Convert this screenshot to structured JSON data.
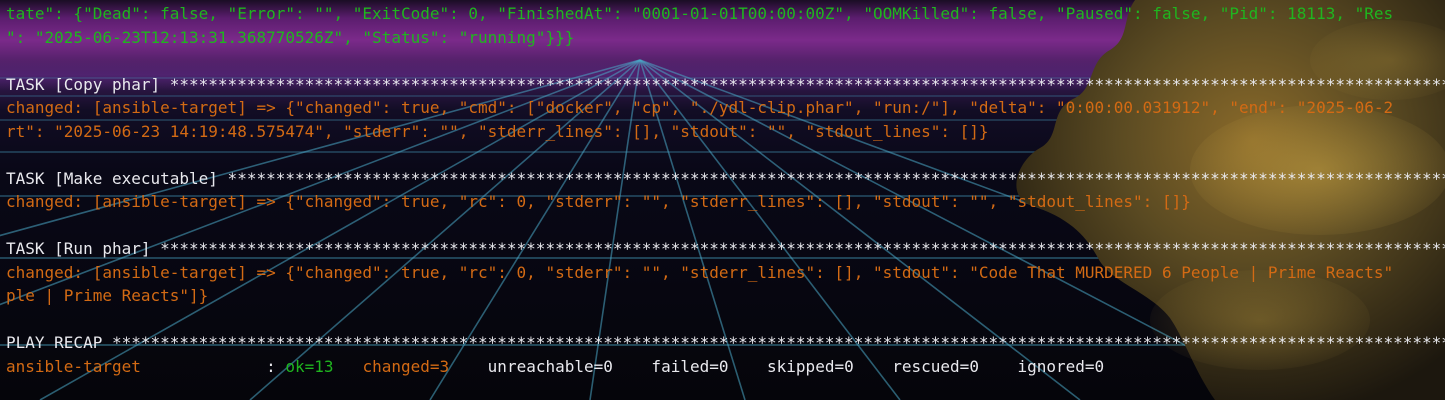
{
  "terminal": {
    "lines": [
      {
        "text": "tate\": {\"Dead\": false, \"Error\": \"\", \"ExitCode\": 0, \"FinishedAt\": \"0001-01-01T00:00:00Z\", \"OOMKilled\": false, \"Paused\": false, \"Pid\": 18113, \"Res",
        "color": "green"
      },
      {
        "text": "\": \"2025-06-23T12:13:31.368770526Z\", \"Status\": \"running\"}}}",
        "color": "green"
      },
      {
        "text": "",
        "color": "white"
      },
      {
        "text": "TASK [Copy phar] ************************************************************************************************************************************************************",
        "color": "white"
      },
      {
        "text": "changed: [ansible-target] => {\"changed\": true, \"cmd\": [\"docker\", \"cp\", \"./ydl-clip.phar\", \"run:/\"], \"delta\": \"0:00:00.031912\", \"end\": \"2025-06-2",
        "color": "orange"
      },
      {
        "text": "rt\": \"2025-06-23 14:19:48.575474\", \"stderr\": \"\", \"stderr_lines\": [], \"stdout\": \"\", \"stdout_lines\": []}",
        "color": "orange"
      },
      {
        "text": "",
        "color": "white"
      },
      {
        "text": "TASK [Make executable] ******************************************************************************************************************************************************",
        "color": "white"
      },
      {
        "text": "changed: [ansible-target] => {\"changed\": true, \"rc\": 0, \"stderr\": \"\", \"stderr_lines\": [], \"stdout\": \"\", \"stdout_lines\": []}",
        "color": "orange"
      },
      {
        "text": "",
        "color": "white"
      },
      {
        "text": "TASK [Run phar] *************************************************************************************************************************************************************",
        "color": "white"
      },
      {
        "text": "changed: [ansible-target] => {\"changed\": true, \"rc\": 0, \"stderr\": \"\", \"stderr_lines\": [], \"stdout\": \"Code That MURDERED 6 People | Prime Reacts\"",
        "color": "orange"
      },
      {
        "text": "ple | Prime Reacts\"]}",
        "color": "orange"
      },
      {
        "text": "",
        "color": "white"
      },
      {
        "text": "PLAY RECAP **************************************************************************************************************************************************************",
        "color": "white"
      }
    ],
    "recap": {
      "host": "ansible-target",
      "sep": "             : ",
      "ok": "ok=13",
      "gap1": "   ",
      "changed": "changed=3",
      "gap2": "    ",
      "rest": "unreachable=0    failed=0    skipped=0    rescued=0    ignored=0"
    },
    "colors": {
      "white": "#e9e9ee",
      "green": "#1fb51f",
      "orange": "#d36a14",
      "background": "#05050a"
    }
  }
}
